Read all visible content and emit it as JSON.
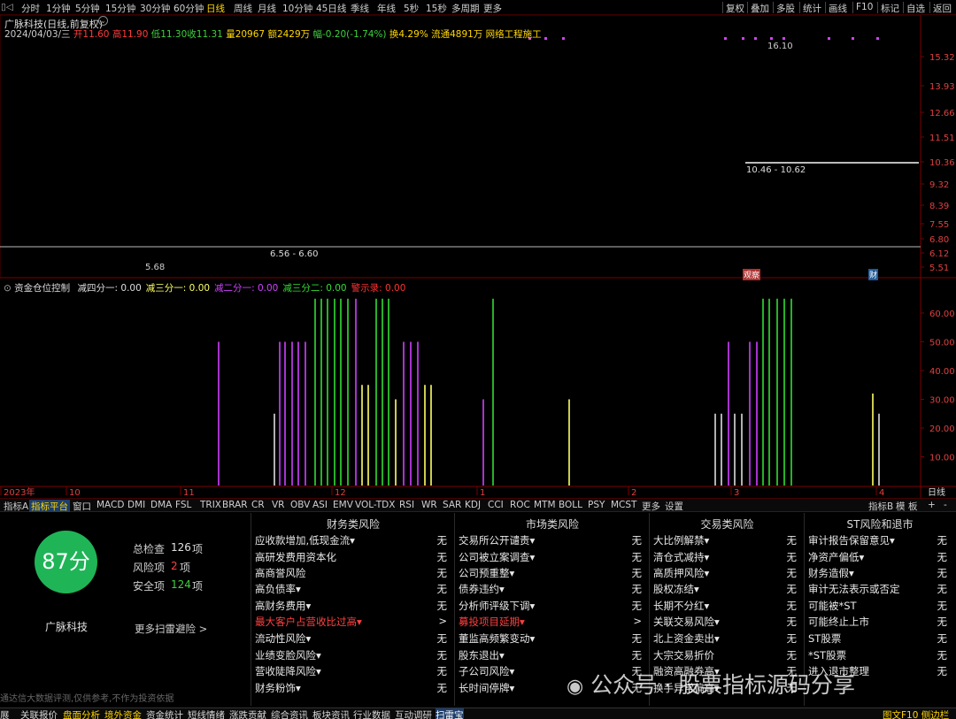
{
  "toolbar": {
    "periods": [
      "分时",
      "1分钟",
      "5分钟",
      "15分钟",
      "30分钟",
      "60分钟",
      "日线",
      "周线",
      "月线",
      "10分钟",
      "45日线",
      "季线",
      "年线",
      "5秒",
      "15秒",
      "多周期",
      "更多"
    ],
    "active_period": "日线",
    "right_buttons": [
      "复权",
      "叠加",
      "多股",
      "统计",
      "画线",
      "F10",
      "标记",
      "自选",
      "返回"
    ]
  },
  "stock": {
    "title": "广脉科技(日线,前复权)",
    "date": "2024/04/03/三",
    "open_label": "开",
    "open": "11.60",
    "high_label": "高",
    "high": "11.90",
    "low_label": "低",
    "low": "11.30",
    "close_label": "收",
    "close": "11.31",
    "volume_label": "量",
    "volume": "20967",
    "amount_label": "额",
    "amount": "2429万",
    "change_label": "幅",
    "change": "-0.20(-1.74%)",
    "turnover_label": "换",
    "turnover": "4.29%",
    "float_label": "流通",
    "float": "4891万",
    "sector": "网络工程施工"
  },
  "price_axis": [
    "15.32",
    "13.93",
    "12.66",
    "11.51",
    "10.36",
    "9.32",
    "8.39",
    "7.55",
    "6.80",
    "6.12",
    "5.51"
  ],
  "annotations": {
    "high": "16.10",
    "low": "5.68",
    "range_high": "10.46 - 10.62",
    "range_low": "6.56 - 6.60",
    "marker_1": "观察",
    "marker_2": "财"
  },
  "indicator": {
    "name": "资金仓位控制",
    "items": [
      {
        "label": "减四分一",
        "value": "0.00",
        "color": "#dddddd"
      },
      {
        "label": "减三分一",
        "value": "0.00",
        "color": "#ffff66"
      },
      {
        "label": "减二分一",
        "value": "0.00",
        "color": "#d040ff"
      },
      {
        "label": "减三分二",
        "value": "0.00",
        "color": "#33dd33"
      },
      {
        "label": "警示录",
        "value": "0.00",
        "color": "#ff3333"
      }
    ],
    "axis": [
      "60.00",
      "50.00",
      "40.00",
      "30.00",
      "20.00",
      "10.00"
    ]
  },
  "time_axis": [
    "2023年",
    "10",
    "11",
    "12",
    "1",
    "2",
    "3",
    "4"
  ],
  "time_right": "日线",
  "tabs": [
    "指标A",
    "指标平台",
    "窗口",
    "MACD",
    "DMI",
    "DMA",
    "FSL",
    "TRIX",
    "BRAR",
    "CR",
    "VR",
    "OBV",
    "ASI",
    "EMV",
    "VOL-TDX",
    "RSI",
    "WR",
    "SAR",
    "KDJ",
    "CCI",
    "ROC",
    "MTM",
    "BOLL",
    "PSY",
    "MCST",
    "更多",
    "设置"
  ],
  "tabs_selected": "指标平台",
  "tabs_right": [
    "指标B",
    "模",
    "板",
    "+",
    "-"
  ],
  "scan": {
    "score": "87分",
    "stock_name": "广脉科技",
    "total_label": "总检查",
    "total": "126",
    "total_unit": "项",
    "risk_label": "风险项",
    "risk": "2",
    "risk_unit": "项",
    "safe_label": "安全项",
    "safe": "124",
    "safe_unit": "项",
    "more": "更多扫雷避险 >",
    "disclaimer": "通达信大数据评测,仅供参考,不作为投资依据",
    "columns": [
      {
        "title": "财务类风险",
        "items": [
          {
            "label": "应收款增加,低现金流▾",
            "result": "无",
            "red": false
          },
          {
            "label": "高研发费用资本化",
            "result": "无",
            "red": false
          },
          {
            "label": "高商誉风险",
            "result": "无",
            "red": false
          },
          {
            "label": "高负债率▾",
            "result": "无",
            "red": false
          },
          {
            "label": "高财务费用▾",
            "result": "无",
            "red": false
          },
          {
            "label": "最大客户占营收比过高▾",
            "result": ">",
            "red": true
          },
          {
            "label": "流动性风险▾",
            "result": "无",
            "red": false
          },
          {
            "label": "业绩变脸风险▾",
            "result": "无",
            "red": false
          },
          {
            "label": "营收陡降风险▾",
            "result": "无",
            "red": false
          },
          {
            "label": "财务粉饰▾",
            "result": "无",
            "red": false
          }
        ]
      },
      {
        "title": "市场类风险",
        "items": [
          {
            "label": "交易所公开谴责▾",
            "result": "无",
            "red": false
          },
          {
            "label": "公司被立案调查▾",
            "result": "无",
            "red": false
          },
          {
            "label": "公司预重整▾",
            "result": "无",
            "red": false
          },
          {
            "label": "债券违约▾",
            "result": "无",
            "red": false
          },
          {
            "label": "分析师评级下调▾",
            "result": "无",
            "red": false
          },
          {
            "label": "募投项目延期▾",
            "result": ">",
            "red": true
          },
          {
            "label": "董监高频繁变动▾",
            "result": "无",
            "red": false
          },
          {
            "label": "股东退出▾",
            "result": "无",
            "red": false
          },
          {
            "label": "子公司风险▾",
            "result": "无",
            "red": false
          },
          {
            "label": "长时间停牌▾",
            "result": "无",
            "red": false
          }
        ]
      },
      {
        "title": "交易类风险",
        "items": [
          {
            "label": "大比例解禁▾",
            "result": "无",
            "red": false
          },
          {
            "label": "清仓式减持▾",
            "result": "无",
            "red": false
          },
          {
            "label": "高质押风险▾",
            "result": "无",
            "red": false
          },
          {
            "label": "股权冻结▾",
            "result": "无",
            "red": false
          },
          {
            "label": "长期不分红▾",
            "result": "无",
            "red": false
          },
          {
            "label": "关联交易风险▾",
            "result": "无",
            "red": false
          },
          {
            "label": "北上资金卖出▾",
            "result": "无",
            "red": false
          },
          {
            "label": "大宗交易折价",
            "result": "无",
            "red": false
          },
          {
            "label": "融资高融券高▾",
            "result": "无",
            "red": false
          },
          {
            "label": "换手异常偏高▾",
            "result": "无",
            "red": false
          }
        ]
      },
      {
        "title": "ST风险和退市",
        "items": [
          {
            "label": "审计报告保留意见▾",
            "result": "无",
            "red": false
          },
          {
            "label": "净资产偏低▾",
            "result": "无",
            "red": false
          },
          {
            "label": "财务造假▾",
            "result": "无",
            "red": false
          },
          {
            "label": "审计无法表示或否定",
            "result": "无",
            "red": false
          },
          {
            "label": "可能被*ST",
            "result": "无",
            "red": false
          },
          {
            "label": "可能终止上市",
            "result": "无",
            "red": false
          },
          {
            "label": "ST股票",
            "result": "无",
            "red": false
          },
          {
            "label": "*ST股票",
            "result": "无",
            "red": false
          },
          {
            "label": "进入退市整理",
            "result": "无",
            "red": false
          },
          {
            "label": "",
            "result": "",
            "red": false
          }
        ]
      }
    ]
  },
  "watermark": "公众号 · 股票指标源码分享",
  "bottom_tabs": [
    "展",
    "关联报价",
    "盘面分析",
    "境外资金",
    "资金统计",
    "短线情绪",
    "涨跌贡献",
    "综合资讯",
    "板块资讯",
    "行业数据",
    "互动调研",
    "扫雷宝"
  ],
  "bottom_selected": "扫雷宝",
  "bottom_right": "图文F10 侧边栏"
}
